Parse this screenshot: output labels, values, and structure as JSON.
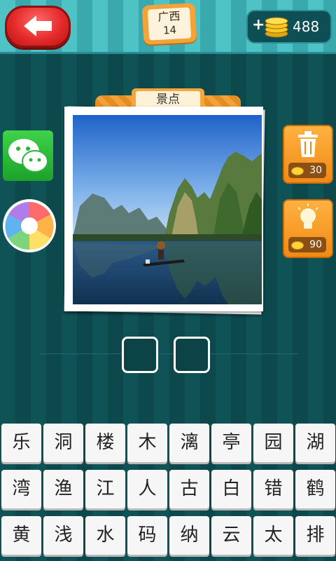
{
  "header": {
    "back_icon": "back-arrow-icon",
    "level_name": "广西",
    "level_number": "14",
    "coins_plus": "+",
    "coins": "488",
    "coin_icon": "coin-stack-icon"
  },
  "puzzle": {
    "category": "景点",
    "image": "landscape-photo-karst-mountains-river-boat",
    "answer_length": 2
  },
  "side_buttons": {
    "share_wechat_icon": "wechat-icon",
    "share_moments_icon": "moments-shutter-icon",
    "remove_cost": "30",
    "remove_icon": "trash-icon",
    "hint_cost": "90",
    "hint_icon": "lightbulb-icon"
  },
  "keyboard": {
    "rows": [
      [
        "乐",
        "洞",
        "楼",
        "木",
        "漓",
        "亭",
        "园",
        "湖"
      ],
      [
        "湾",
        "渔",
        "江",
        "人",
        "古",
        "白",
        "错",
        "鹤"
      ],
      [
        "黄",
        "浅",
        "水",
        "码",
        "纳",
        "云",
        "太",
        "排"
      ]
    ]
  },
  "colors": {
    "accent_orange": "#f08a15",
    "back_red": "#e52b2b",
    "bg_teal": "#0e4e52",
    "topbar_teal": "#4fc2c6"
  }
}
